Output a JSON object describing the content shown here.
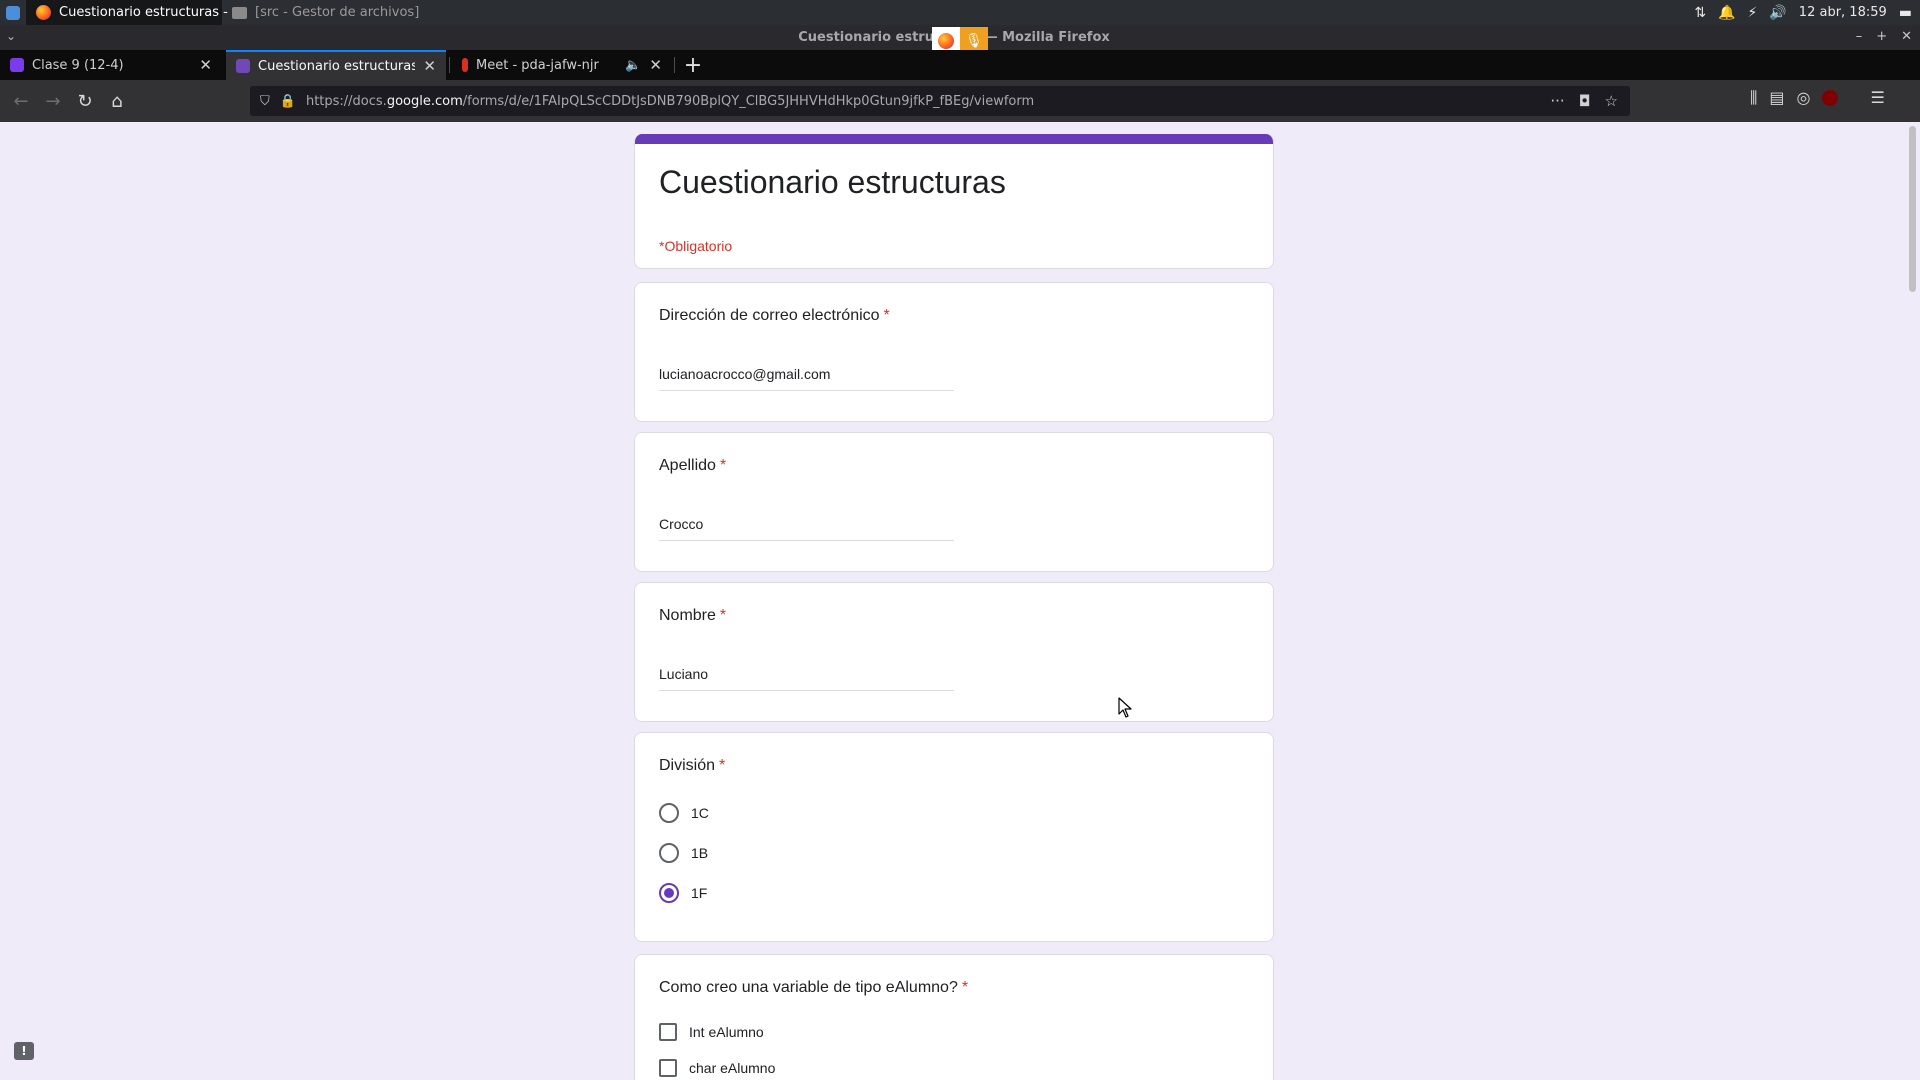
{
  "taskbar": {
    "tasks": [
      {
        "label": "Cuestionario estructuras - ..."
      },
      {
        "label": "[src - Gestor de archivos]"
      }
    ],
    "clock": "12 abr, 18:59"
  },
  "window": {
    "title": "Cuestionario estructuras — Mozilla Firefox"
  },
  "tabs": [
    {
      "label": "Clase 9 (12-4)"
    },
    {
      "label": "Cuestionario estructuras"
    },
    {
      "label": "Meet - pda-jafw-njr"
    }
  ],
  "navbar": {
    "url_prefix": "https://docs.",
    "url_host": "google.com",
    "url_path": "/forms/d/e/1FAIpQLScCDDtJsDNB790BplQY_ClBG5JHHVHdHkp0Gtun9jfkP_fBEg/viewform"
  },
  "form": {
    "title": "Cuestionario estructuras",
    "required_note": "*Obligatorio",
    "required_marker": "*",
    "questions": [
      {
        "title": "Dirección de correo electrónico",
        "value": "lucianoacrocco@gmail.com"
      },
      {
        "title": "Apellido",
        "value": "Crocco"
      },
      {
        "title": "Nombre",
        "value": "Luciano"
      },
      {
        "title": "División",
        "options": [
          "1C",
          "1B",
          "1F"
        ],
        "selected": "1F"
      },
      {
        "title": "Como creo una variable de tipo eAlumno?",
        "options": [
          "Int eAlumno",
          "char eAlumno"
        ]
      }
    ]
  },
  "colors": {
    "accent": "#673ab7",
    "required": "#d93025",
    "background": "#f0ebf8"
  }
}
